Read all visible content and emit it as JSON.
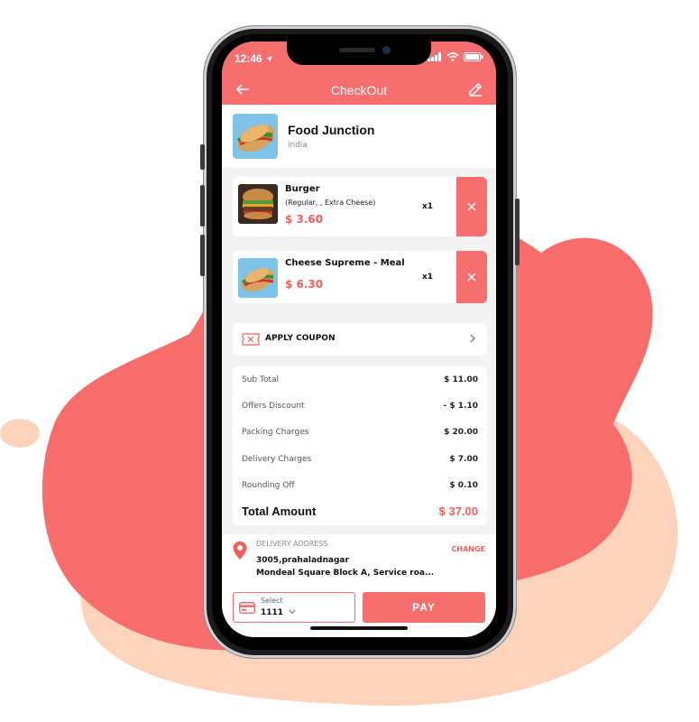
{
  "colors": {
    "accent": "#f66f6e",
    "price": "#f25f5c",
    "blob": "#f76d6c",
    "blob_light": "#fdd3bc"
  },
  "status_bar": {
    "time": "12:46",
    "icons": [
      "location-arrow-icon",
      "signal-icon",
      "wifi-icon",
      "battery-icon"
    ]
  },
  "header": {
    "title": "CheckOut",
    "back_icon": "arrow-left-icon",
    "edit_icon": "pencil-icon"
  },
  "restaurant": {
    "name": "Food Junction",
    "location": "india"
  },
  "cart": {
    "items": [
      {
        "name": "Burger",
        "options": "(Regular, , Extra Cheese)",
        "price": "$ 3.60",
        "qty": "x1",
        "remove_icon": "close-icon"
      },
      {
        "name": "Cheese Supreme -  Meal",
        "options": "",
        "price": "$ 6.30",
        "qty": "x1",
        "remove_icon": "close-icon"
      }
    ]
  },
  "coupon": {
    "label": "APPLY COUPON",
    "icon": "coupon-ticket-icon",
    "chevron": "chevron-right-icon"
  },
  "summary": {
    "rows": [
      {
        "label": "Sub Total",
        "value": "$ 11.00"
      },
      {
        "label": "Offers Discount",
        "value": "- $ 1.10"
      },
      {
        "label": "Packing Charges",
        "value": "$ 20.00"
      },
      {
        "label": "Delivery Charges",
        "value": "$ 7.00"
      },
      {
        "label": "Rounding Off",
        "value": "$ 0.10"
      }
    ],
    "total_label": "Total Amount",
    "total_value": "$ 37.00"
  },
  "address": {
    "label": "DELIVERY ADDRESS",
    "line1": "3005,prahaladnagar",
    "line2": "Mondeal Square Block A, Service roa...",
    "change_label": "CHANGE"
  },
  "payment": {
    "select_label": "Select",
    "select_value": "1111",
    "pay_label": "PAY"
  }
}
